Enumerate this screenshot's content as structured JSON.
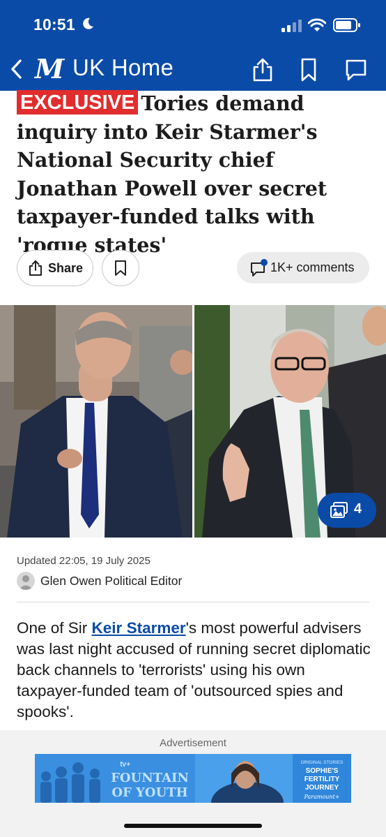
{
  "status_bar": {
    "time": "10:51"
  },
  "nav": {
    "title": "UK Home"
  },
  "article": {
    "badge": "EXCLUSIVE",
    "headline": "Tories demand inquiry into Keir Starmer's National Security chief Jonathan Powell over secret taxpayer-funded talks with 'rogue states'",
    "actions": {
      "share_label": "Share",
      "comments_label": "1K+ comments"
    },
    "gallery_count": "4",
    "updated": "Updated 22:05, 19 July 2025",
    "author": "Glen Owen Political Editor",
    "body": {
      "prefix": "One of Sir ",
      "link_text": "Keir Starmer",
      "suffix": "'s most powerful advisers was last night accused of running secret diplomatic back channels to 'terrorists' using his own taxpayer-funded team of 'outsourced spies and spooks'."
    }
  },
  "advertisement": {
    "label": "Advertisement",
    "brand": "tv+",
    "title_line1": "FOUNTAIN",
    "title_line2": "OF YOUTH",
    "side_kicker": "ORIGINAL STORIES",
    "side_line1": "SOPHIE'S",
    "side_line2": "FERTILITY",
    "side_line3": "JOURNEY",
    "side_brand": "Paramount+"
  },
  "colors": {
    "brand_blue": "#0a4ba8",
    "exclusive_red": "#e12d2d"
  }
}
